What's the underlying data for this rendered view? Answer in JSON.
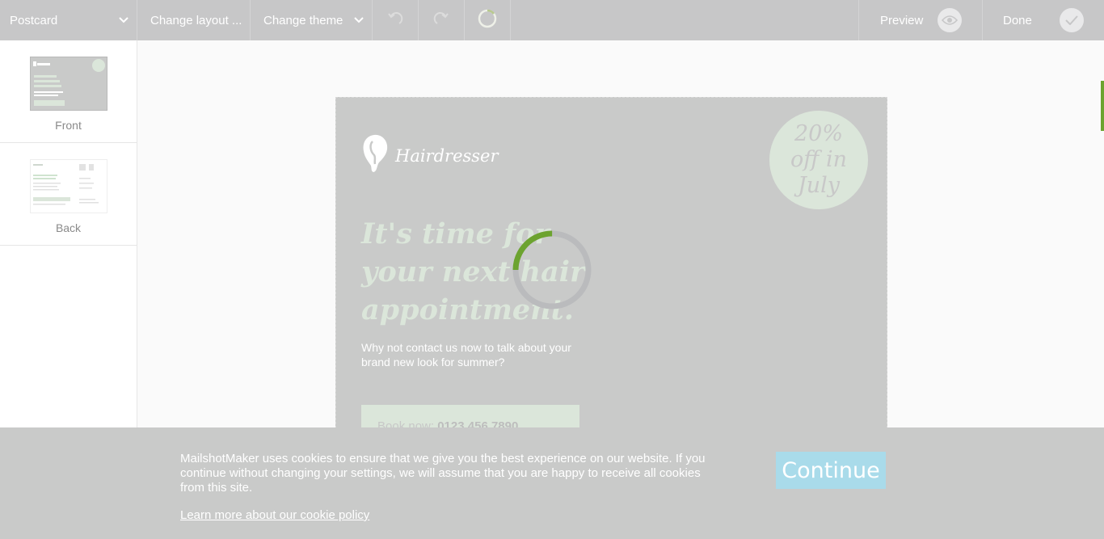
{
  "toolbar": {
    "product": "Postcard",
    "change_layout": "Change layout ...",
    "change_theme": "Change theme",
    "preview": "Preview",
    "done": "Done"
  },
  "sidebar": {
    "pages": [
      {
        "label": "Front"
      },
      {
        "label": "Back"
      }
    ]
  },
  "postcard": {
    "brand": "Hairdresser",
    "badge_lines": [
      "20%",
      "off in",
      "July"
    ],
    "headline_lines": [
      "It's time for",
      "your next hair",
      "appointment."
    ],
    "subtext": "Why not contact us now to talk about your brand new look for summer?",
    "book_label": "Book now: ",
    "book_phone": "0123 456 7890"
  },
  "loading_progress": 0.25,
  "cookie": {
    "text": "MailshotMaker uses cookies to ensure that we give you the best experience on our website. If you continue without changing your settings, we will assume that you are happy to receive all cookies from this site.",
    "link": "Learn more about our cookie policy",
    "continue": "Continue"
  },
  "colors": {
    "toolbar": "#c7c7c8",
    "accent_green": "#6ca32f",
    "mint": "#dbe6da",
    "continue_button": "#a9dbea"
  }
}
